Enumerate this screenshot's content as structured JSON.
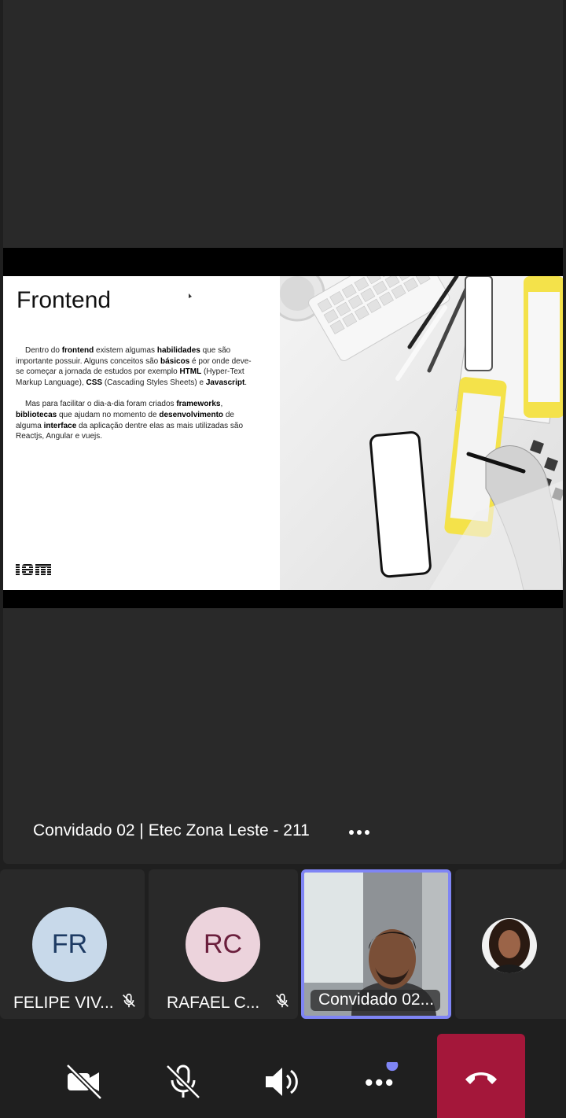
{
  "stage": {
    "caption": "Convidado 02 | Etec Zona Leste - 211",
    "more_label": "More options"
  },
  "slide": {
    "title": "Frontend",
    "p1": [
      {
        "t": "Dentro do "
      },
      {
        "t": "frontend",
        "b": true
      },
      {
        "t": " existem algumas "
      },
      {
        "t": "habilidades",
        "b": true
      },
      {
        "t": " que são importante possuir. Alguns conceitos são "
      },
      {
        "t": "básicos",
        "b": true
      },
      {
        "t": " é por onde deve-se começar a jornada de estudos por exemplo "
      },
      {
        "t": "HTML",
        "b": true
      },
      {
        "t": " (Hyper-Text Markup Language), "
      },
      {
        "t": "CSS",
        "b": true
      },
      {
        "t": " (Cascading Styles Sheets) e "
      },
      {
        "t": "Javascript",
        "b": true
      },
      {
        "t": "."
      }
    ],
    "p2": [
      {
        "t": "Mas para facilitar o dia-a-dia foram criados "
      },
      {
        "t": "frameworks",
        "b": true
      },
      {
        "t": ", "
      },
      {
        "t": "bibliotecas",
        "b": true
      },
      {
        "t": " que ajudam no momento de "
      },
      {
        "t": "desenvolvimento",
        "b": true
      },
      {
        "t": " de alguma "
      },
      {
        "t": "interface",
        "b": true
      },
      {
        "t": " da aplicação dentre elas as mais utilizadas são Reactjs, Angular e vuejs."
      }
    ],
    "logo_text": "IBM."
  },
  "participants": [
    {
      "initials": "FR",
      "name": "FELIPE VIV...",
      "avatar_bg": "#c8d9ea",
      "avatar_fg": "#1d3a63",
      "muted": true
    },
    {
      "initials": "RC",
      "name": "RAFAEL C...",
      "avatar_bg": "#ecd3dc",
      "avatar_fg": "#6a1e3c",
      "muted": true
    },
    {
      "name": "Convidado 02...",
      "video": true,
      "active_speaker_color": "#7f85f5"
    },
    {
      "name": "",
      "photo_avatar": true
    }
  ],
  "controls": {
    "camera": "camera-off-icon",
    "mic": "mic-off-icon",
    "speaker": "speaker-icon",
    "more": "more-icon",
    "more_badge_color": "#7f85f5",
    "end_call": "end-call-icon",
    "end_call_color": "#a4173a"
  }
}
